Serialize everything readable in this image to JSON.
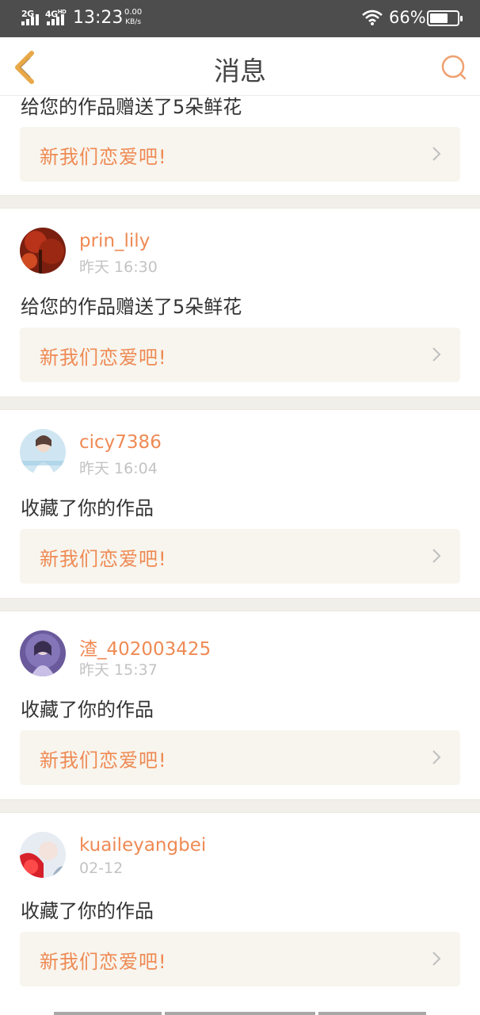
{
  "status_bar": {
    "net1": "2G",
    "net2": "4G",
    "net2_suffix": "HD",
    "time": "13:23",
    "speed_value": "0.00",
    "speed_unit": "KB/s",
    "battery_percent": "66%",
    "battery_level": 0.66
  },
  "header": {
    "title": "消息",
    "back_icon": "chevron-left-icon",
    "search_icon": "search-icon",
    "accent_color": "#e9a848"
  },
  "top_partial": {
    "message": "给您的作品赠送了5朵鲜花",
    "reply_label": "新我们恋爱吧!"
  },
  "messages": [
    {
      "username": "prin_lily",
      "time": "昨天 16:30",
      "message": "给您的作品赠送了5朵鲜花",
      "reply_label": "新我们恋爱吧!"
    },
    {
      "username": "cicy7386",
      "time": "昨天 16:04",
      "message": "收藏了你的作品",
      "reply_label": "新我们恋爱吧!"
    },
    {
      "username": "渣_402003425",
      "time": "昨天 15:37",
      "message": "收藏了你的作品",
      "reply_label": "新我们恋爱吧!"
    },
    {
      "username": "kuaileyangbei",
      "time": "02-12",
      "message": "收藏了你的作品",
      "reply_label": "新我们恋爱吧!"
    }
  ],
  "colors": {
    "username": "#ef8a54",
    "reply_label": "#ef8a54",
    "reply_bg": "#f7f5ee",
    "divider": "#f1efea",
    "status_bar_bg": "#4d4d4d"
  }
}
